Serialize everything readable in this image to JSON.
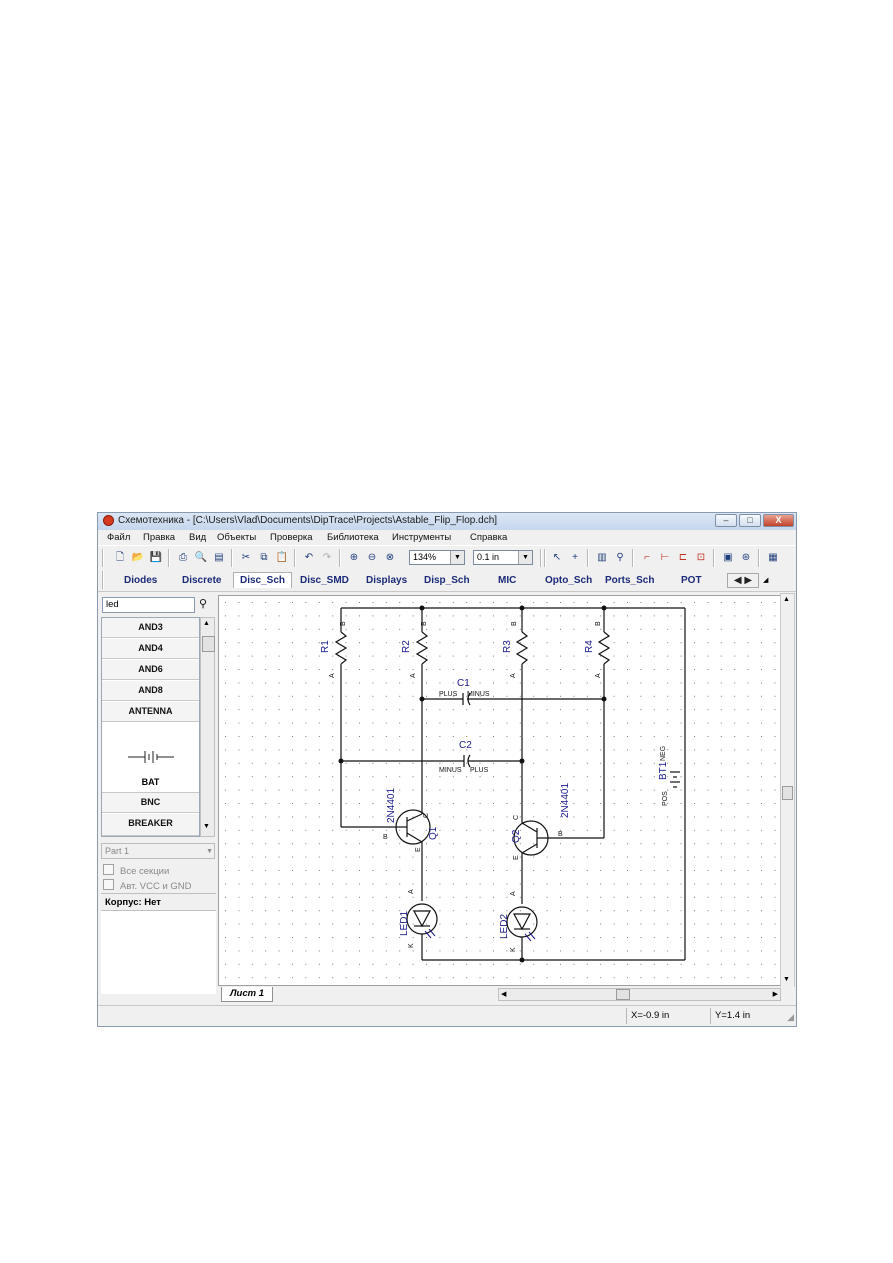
{
  "window": {
    "title": "Схемотехника - [C:\\Users\\Vlad\\Documents\\DipTrace\\Projects\\Astable_Flip_Flop.dch]",
    "minimize": "–",
    "maximize": "□",
    "close": "X"
  },
  "menu": [
    "Файл",
    "Правка",
    "Вид",
    "Объекты",
    "Проверка",
    "Библиотека",
    "Инструменты",
    "Справка"
  ],
  "toolbar": {
    "zoom": "134%",
    "grid": "0.1 in"
  },
  "library_tabs": [
    "Diodes",
    "Discrete",
    "Disc_Sch",
    "Disc_SMD",
    "Displays",
    "Disp_Sch",
    "MIC",
    "Opto_Sch",
    "Ports_Sch",
    "POT"
  ],
  "active_tab": "Disc_Sch",
  "panel": {
    "search_value": "led",
    "components": [
      "AND3",
      "AND4",
      "AND6",
      "AND8",
      "ANTENNA"
    ],
    "selected_component": "BAT",
    "components_after": [
      "BNC",
      "BREAKER"
    ],
    "part_select": "Part 1",
    "checkbox_all_sections": "Все секции",
    "checkbox_auto_vcc": "Авт. VCC и GND",
    "package_label": "Корпус: Нет"
  },
  "schematic": {
    "parts": {
      "R1": "R1",
      "R2": "R2",
      "R3": "R3",
      "R4": "R4",
      "C1": "C1",
      "C2": "C2",
      "Q1": "Q1",
      "Q2": "Q2",
      "Q1_type": "2N4401",
      "Q2_type": "2N4401",
      "LED1": "LED1",
      "LED2": "LED2",
      "BT1": "BT1"
    },
    "pins": {
      "A": "A",
      "B": "B",
      "C": "C",
      "E": "E",
      "K": "K",
      "plus": "PLUS",
      "minus": "MINUS",
      "pos": "POS",
      "neg": "NEG"
    }
  },
  "sheet_tab": "Лист 1",
  "status": {
    "x": "X=-0.9 in",
    "y": "Y=1.4 in"
  }
}
